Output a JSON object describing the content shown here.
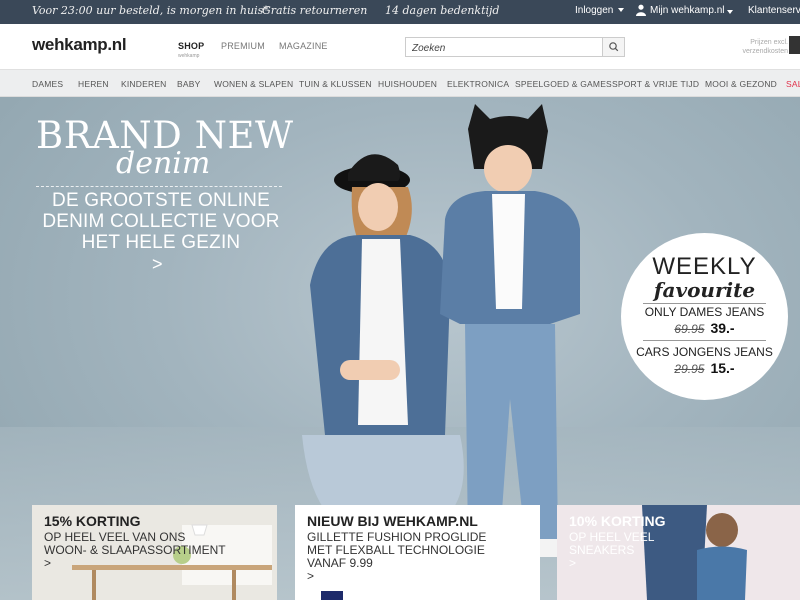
{
  "topbar": {
    "promo1": "Voor 23:00 uur besteld, is morgen in huis*",
    "promo2": "Gratis retourneren",
    "promo3": "14 dagen bedenktijd",
    "login": "Inloggen",
    "account": "Mijn wehkamp.nl",
    "service": "Klantenservice"
  },
  "header": {
    "logo": "wehkamp.nl",
    "tabs": [
      "SHOP",
      "PREMIUM",
      "MAGAZINE"
    ],
    "shop_sub": "wehkamp",
    "search_placeholder": "Zoeken",
    "cart_text": "Prijzen excl. verzendkosten"
  },
  "categories": [
    "DAMES",
    "HEREN",
    "KINDEREN",
    "BABY",
    "WONEN & SLAPEN",
    "TUIN & KLUSSEN",
    "HUISHOUDEN",
    "ELEKTRONICA",
    "SPEELGOED & GAMES",
    "SPORT & VRIJE TIJD",
    "MOOI & GEZOND",
    "SALE"
  ],
  "hero": {
    "title": "BRAND NEW",
    "script": "denim",
    "sub": "DE GROOTSTE ONLINE DENIM COLLECTIE VOOR HET HELE GEZIN",
    "arrow": ">"
  },
  "weekly": {
    "title": "WEEKLY",
    "subtitle": "favourite",
    "item1": "ONLY DAMES JEANS",
    "item1_old": "69.95",
    "item1_new": "39.-",
    "item2": "CARS JONGENS JEANS",
    "item2_old": "29.95",
    "item2_new": "15.-"
  },
  "cards": [
    {
      "title": "15% KORTING",
      "line1": "OP HEEL VEEL VAN ONS",
      "line2": "WOON- & SLAAPASSORTIMENT",
      "arrow": ">"
    },
    {
      "title": "NIEUW BIJ WEHKAMP.NL",
      "line1": "GILLETTE FUSHION PROGLIDE",
      "line2": "MET FLEXBALL TECHNOLOGIE",
      "line3": "VANAF 9.99",
      "arrow": ">"
    },
    {
      "title": "10% KORTING",
      "line1": "OP HEEL VEEL",
      "line2": "SNEAKERS",
      "arrow": ">"
    }
  ],
  "colors": {
    "topbar": "#3a4858",
    "sale": "#e0304a",
    "hero_bg": "#a2b4be"
  }
}
